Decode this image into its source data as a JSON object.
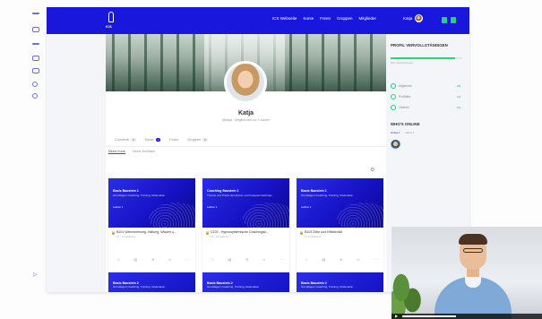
{
  "app": {
    "logo_text": "ICS",
    "nav": [
      "ICS Webseite",
      "Kurse",
      "Foren",
      "Gruppen",
      "Mitglieder"
    ],
    "user_name": "Katja"
  },
  "profile": {
    "name": "Katja",
    "subtitle": "@katja · Mitglied seit vor 3 Jahren",
    "tabs": [
      {
        "label": "Connects",
        "badge": "0"
      },
      {
        "label": "Kurse",
        "badge": "7"
      },
      {
        "label": "Foren",
        "badge": ""
      },
      {
        "label": "Gruppen",
        "badge": "0"
      }
    ],
    "subtabs": [
      "Meine Kurse",
      "Meine Zertifikate"
    ]
  },
  "cards": [
    {
      "category": "Basis Baustein 1",
      "subtitle": "Grundlagen Coaching, Training, Moderation",
      "stat": "Lektion 1",
      "title": "B101 Wahrnehmung, Haltung, Wissen u...",
      "meta": "14 / 14 Lektionen"
    },
    {
      "category": "Coaching Baustein 1",
      "subtitle": "Theorie und Praxis des Einzel- und Gruppencoachings",
      "stat": "Lektion 1",
      "title": "C102 - Hypnosystemische Coachingan...",
      "meta": "12 / 12 Lektionen"
    },
    {
      "category": "Basis Baustein 1",
      "subtitle": "Grundlagen Coaching, Training, Moderation",
      "stat": "Lektion 1",
      "title": "B103 Ziele und Effektivität",
      "meta": "9 / 9 Lektionen"
    }
  ],
  "cards_row2": [
    {
      "category": "Basis Baustein 2",
      "subtitle": "Grundlagen Coaching, Training, Moderation"
    },
    {
      "category": "Basis Baustein 2",
      "subtitle": "Grundlagen Coaching, Training, Moderation"
    },
    {
      "category": "Basis Baustein 2",
      "subtitle": "Grundlagen Coaching, Training, Moderation"
    }
  ],
  "sidebar": {
    "heading": "PROFIL VERVOLLSTÄNDIGEN",
    "progress_pct": 0.9,
    "progress_label": "90% abgeschlossen",
    "items": [
      {
        "label": "Allgemein",
        "badge": "3/3"
      },
      {
        "label": "Profilbild",
        "badge": "1/1"
      },
      {
        "label": "Titelbild",
        "badge": "1/1"
      }
    ],
    "who_heading": "WHO'S ONLINE",
    "who_tabs": [
      "Online 1",
      "Aktive 1"
    ]
  },
  "colors": {
    "brand": "#1a17dc",
    "accent": "#24d47a"
  }
}
